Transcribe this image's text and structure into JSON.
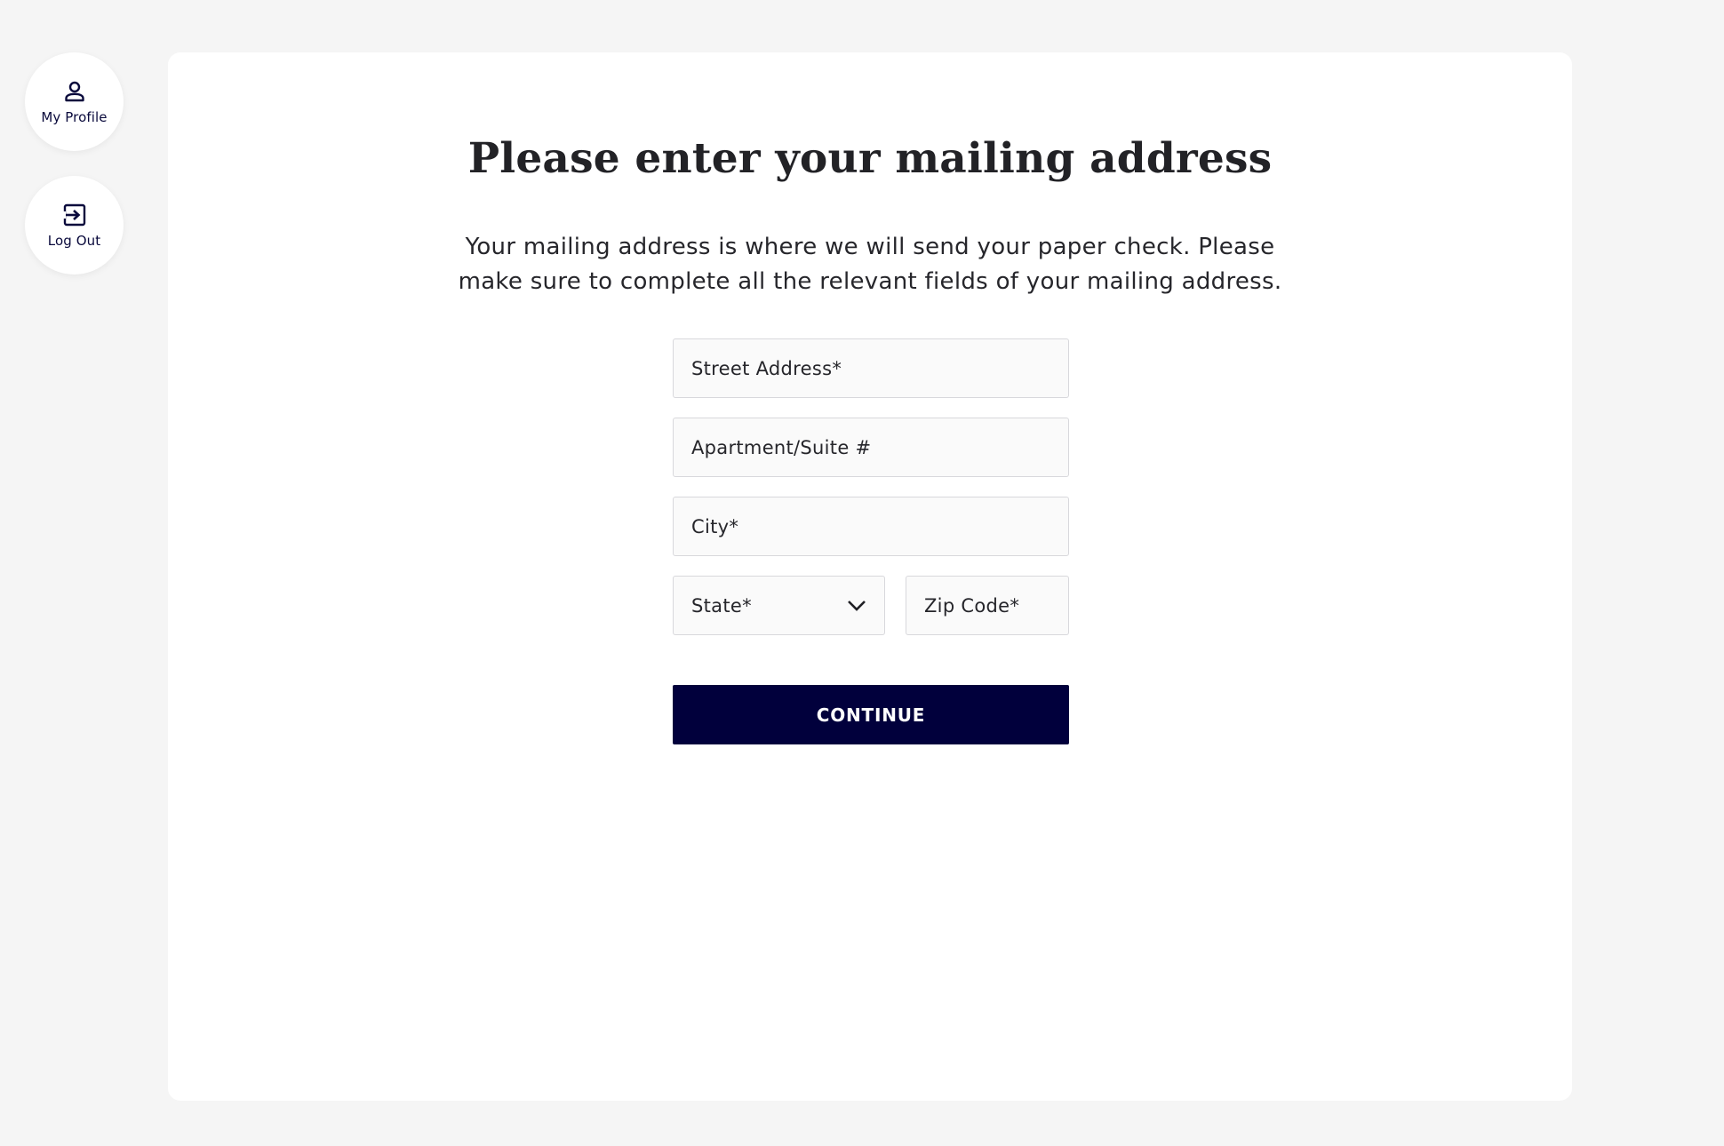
{
  "nav": {
    "profile": {
      "label": "My Profile",
      "icon": "person-icon"
    },
    "logout": {
      "label": "Log Out",
      "icon": "logout-icon"
    }
  },
  "page": {
    "title": "Please enter your mailing address",
    "subtitle": "Your mailing address is where we will send your paper check. Please make sure to complete all the relevant fields of your mailing address."
  },
  "form": {
    "street": {
      "placeholder": "Street Address*",
      "value": ""
    },
    "apartment": {
      "placeholder": "Apartment/Suite #",
      "value": ""
    },
    "city": {
      "placeholder": "City*",
      "value": ""
    },
    "state": {
      "label": "State*"
    },
    "zip": {
      "placeholder": "Zip Code*",
      "value": ""
    },
    "continue_label": "CONTINUE"
  },
  "colors": {
    "background": "#f5f5f5",
    "card": "#ffffff",
    "primary": "#01003c",
    "field_bg": "#fafafa",
    "field_border": "#d8d8dc"
  }
}
